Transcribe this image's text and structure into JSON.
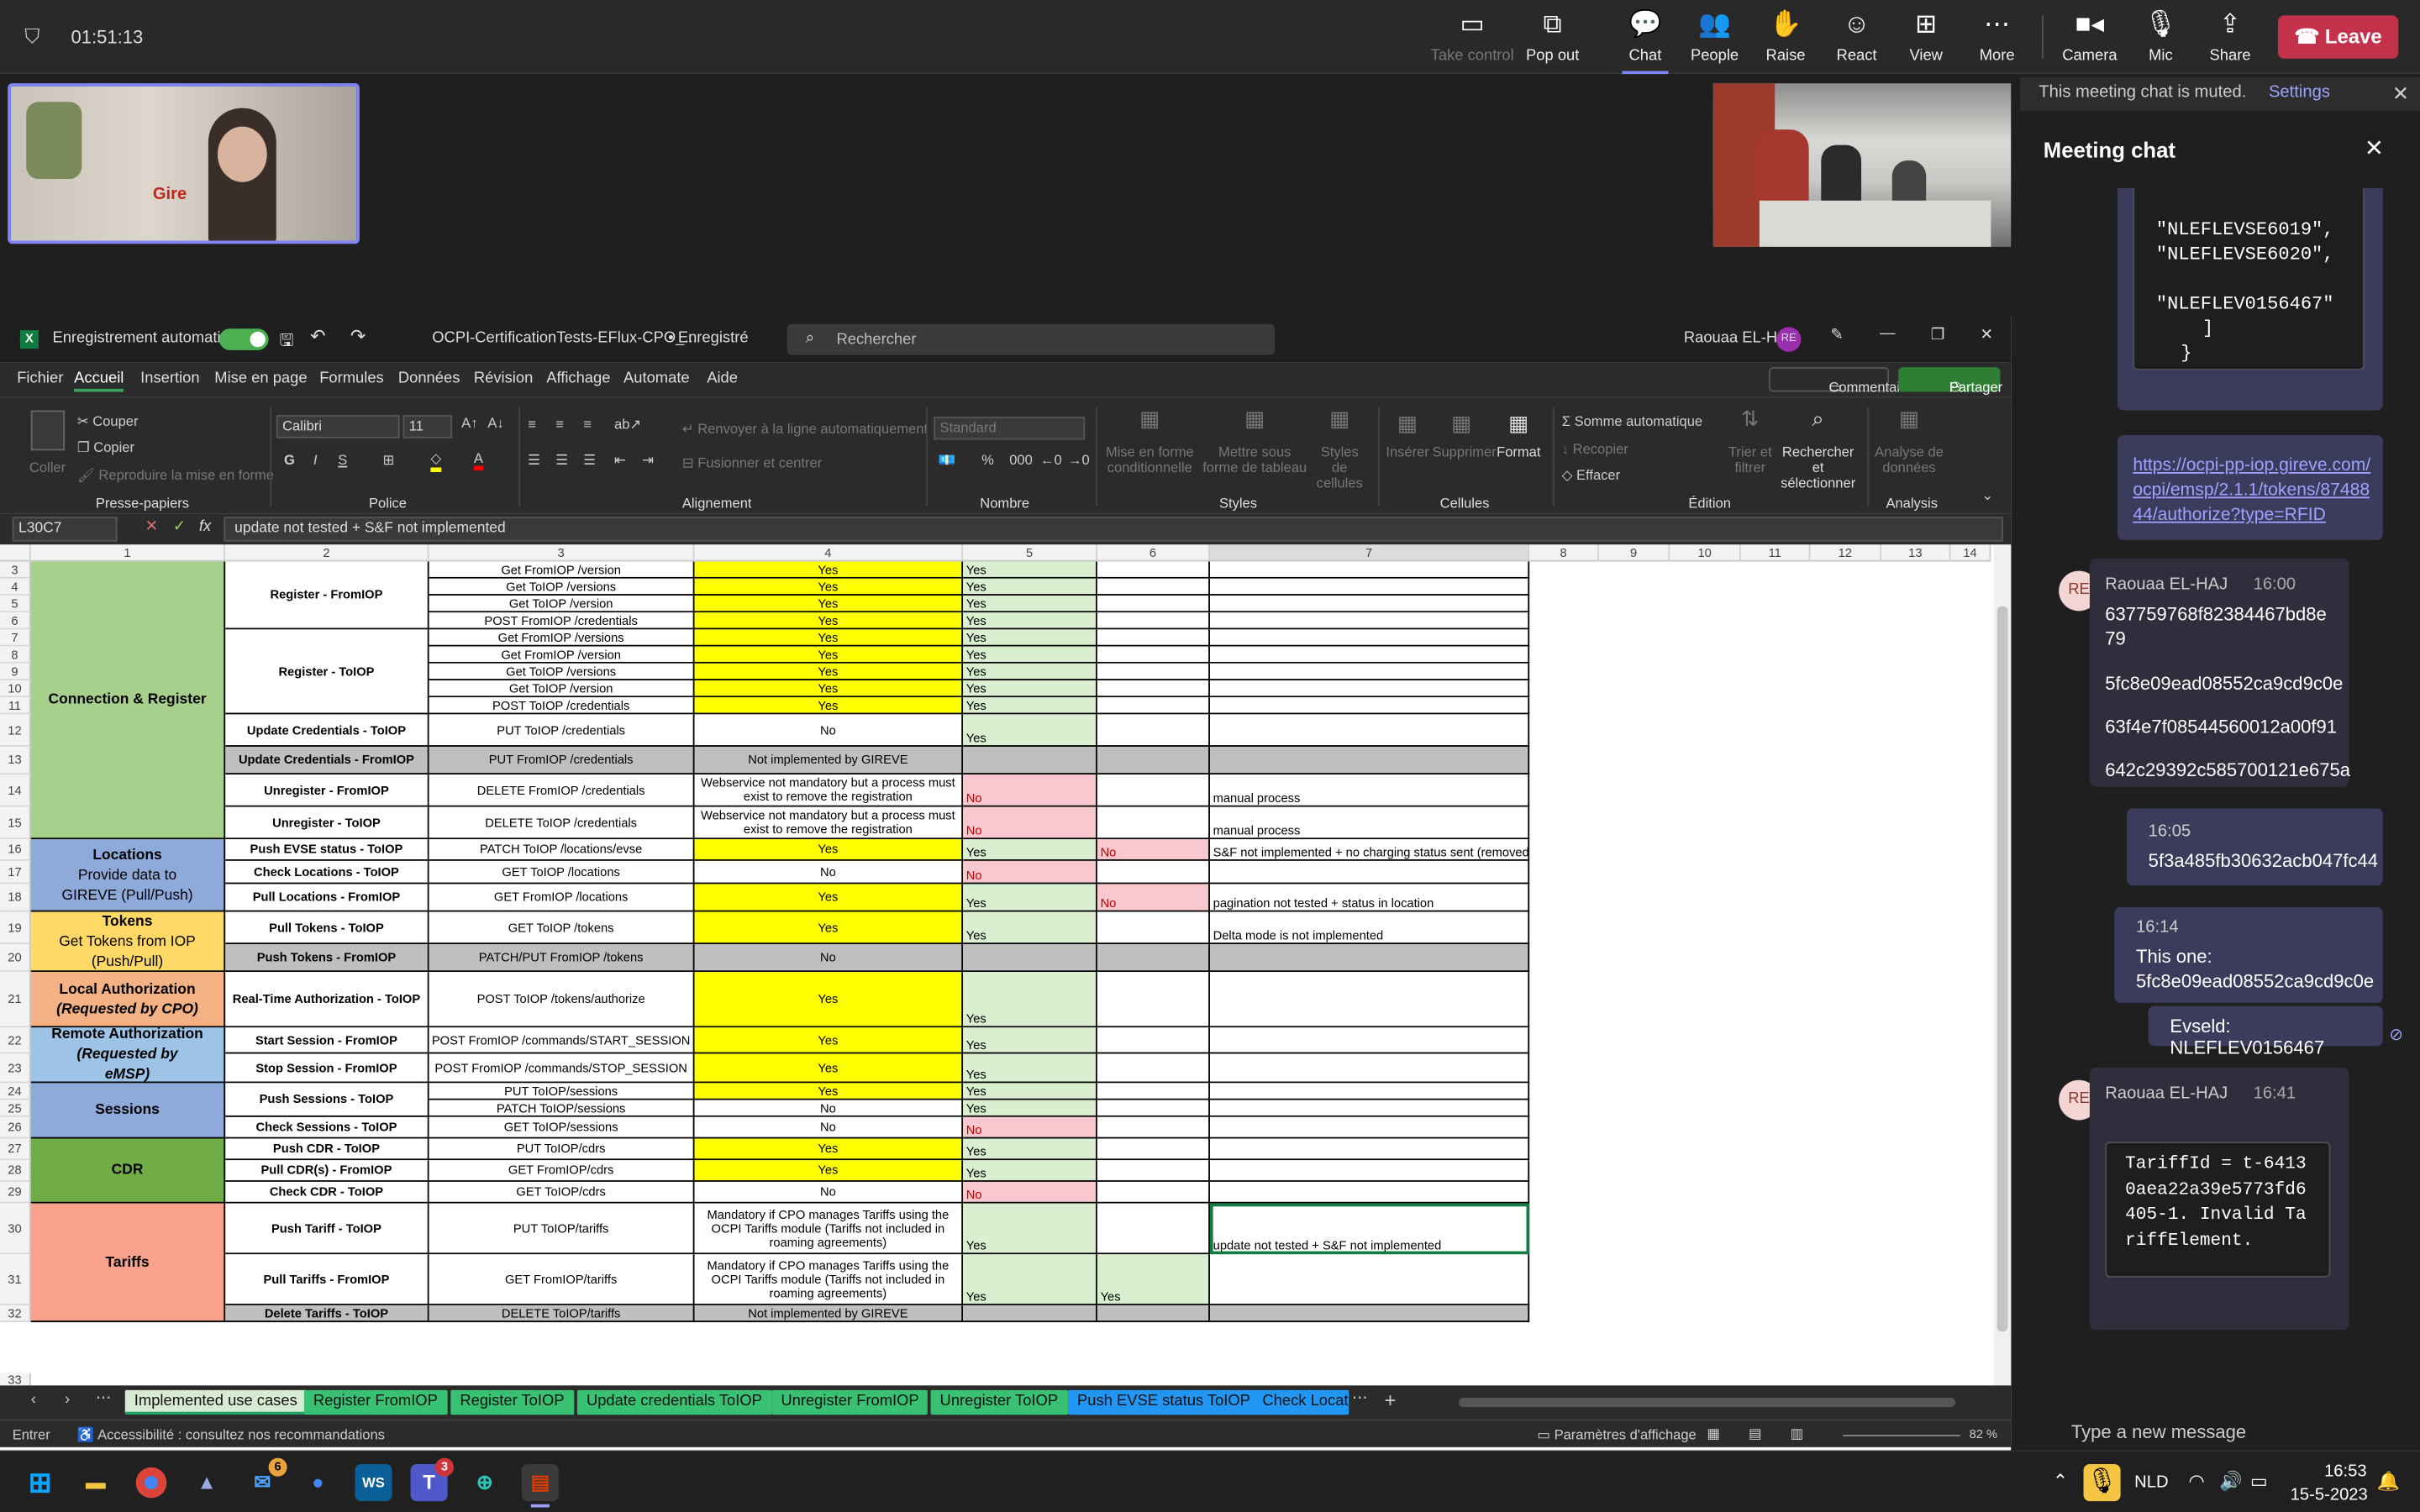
{
  "meeting": {
    "time": "01:51:13",
    "buttons": [
      "Take control",
      "Pop out",
      "Chat",
      "People",
      "Raise",
      "React",
      "View",
      "More",
      "Camera",
      "Mic",
      "Share"
    ],
    "leave": "Leave"
  },
  "excel": {
    "autosave": "Enregistrement automatique",
    "filename": "OCPI-CertificationTests-EFlux-CPO_...",
    "saved": "• Enregistré",
    "search": "Rechercher",
    "user": "Raouaa EL-HAJ",
    "initials": "RE",
    "menu": [
      "Fichier",
      "Accueil",
      "Insertion",
      "Mise en page",
      "Formules",
      "Données",
      "Révision",
      "Affichage",
      "Automate",
      "Aide"
    ],
    "comments": "Commentaires",
    "share": "Partager",
    "clipboard": {
      "paste": "Coller",
      "cut": "Couper",
      "copy": "Copier",
      "format": "Reproduire la mise en forme",
      "group": "Presse-papiers"
    },
    "font": {
      "name": "Calibri",
      "size": "11",
      "group": "Police"
    },
    "align": {
      "wrap": "Renvoyer à la ligne automatiquement",
      "merge": "Fusionner et centrer",
      "group": "Alignement"
    },
    "number": {
      "format": "Standard",
      "group": "Nombre"
    },
    "styles": {
      "cond": "Mise en forme conditionnelle",
      "table": "Mettre sous forme de tableau",
      "cell": "Styles de cellules",
      "group": "Styles"
    },
    "cells": {
      "insert": "Insérer",
      "delete": "Supprimer",
      "format": "Format",
      "group": "Cellules"
    },
    "edit": {
      "sum": "Somme automatique",
      "fill": "Recopier",
      "clear": "Effacer",
      "sort": "Trier et filtrer",
      "find": "Rechercher et sélectionner",
      "group": "Édition"
    },
    "analysis": {
      "label": "Analyse de données",
      "group": "Analysis"
    },
    "namebox": "L30C7",
    "formula": "update not tested + S&F not implemented",
    "columns": [
      "1",
      "2",
      "3",
      "4",
      "5",
      "6",
      "7",
      "8",
      "9",
      "10",
      "11",
      "12",
      "13",
      "14"
    ],
    "groups": [
      {
        "label": "Connection & Register",
        "sub": "",
        "color": "#a8d08d"
      },
      {
        "label": "Locations",
        "sub": "Provide data to GIREVE (Pull/Push)",
        "color": "#8eaadb"
      },
      {
        "label": "Tokens",
        "sub": "Get Tokens from IOP (Push/Pull)",
        "color": "#ffd966"
      },
      {
        "label": "Local Authorization",
        "sub": "(Requested by CPO)",
        "color": "#f4b183"
      },
      {
        "label": "Remote Authorization",
        "sub": "(Requested by eMSP)",
        "color": "#9dc3e6"
      },
      {
        "label": "Sessions",
        "sub": "",
        "color": "#8eaadb"
      },
      {
        "label": "CDR",
        "sub": "",
        "color": "#70ad47"
      },
      {
        "label": "Tariffs",
        "sub": "",
        "color": "#f8a28c"
      }
    ],
    "rows": [
      {
        "n": "3",
        "c3": "Get FromIOP /version",
        "c4": "Yes",
        "c5": "Yes",
        "c6": "",
        "c7": ""
      },
      {
        "n": "4",
        "c3": "Get ToIOP /versions",
        "c4": "Yes",
        "c5": "Yes",
        "c6": "",
        "c7": ""
      },
      {
        "n": "5",
        "c3": "Get ToIOP /version",
        "c4": "Yes",
        "c5": "Yes",
        "c6": "",
        "c7": ""
      },
      {
        "n": "6",
        "c3": "POST FromIOP /credentials",
        "c4": "Yes",
        "c5": "Yes",
        "c6": "",
        "c7": ""
      },
      {
        "n": "7",
        "c3": "Get FromIOP /versions",
        "c4": "Yes",
        "c5": "Yes",
        "c6": "",
        "c7": ""
      },
      {
        "n": "8",
        "c3": "Get FromIOP /version",
        "c4": "Yes",
        "c5": "Yes",
        "c6": "",
        "c7": ""
      },
      {
        "n": "9",
        "c3": "Get ToIOP /versions",
        "c4": "Yes",
        "c5": "Yes",
        "c6": "",
        "c7": ""
      },
      {
        "n": "10",
        "c3": "Get ToIOP /version",
        "c4": "Yes",
        "c5": "Yes",
        "c6": "",
        "c7": ""
      },
      {
        "n": "11",
        "c3": "POST ToIOP /credentials",
        "c4": "Yes",
        "c5": "Yes",
        "c6": "",
        "c7": ""
      },
      {
        "n": "12",
        "c2": "Update Credentials - ToIOP",
        "c3": "PUT ToIOP /credentials",
        "c4": "No",
        "c5": "Yes",
        "c6": "",
        "c7": ""
      },
      {
        "n": "13",
        "c2": "Update Credentials - FromIOP",
        "c3": "PUT FromIOP /credentials",
        "c4": "Not implemented by GIREVE",
        "c5": "",
        "c6": "",
        "c7": ""
      },
      {
        "n": "14",
        "c2": "Unregister - FromIOP",
        "c3": "DELETE FromIOP /credentials",
        "c4": "Webservice not mandatory but a process must exist to remove the registration",
        "c5": "No",
        "c6": "",
        "c7": "manual process"
      },
      {
        "n": "15",
        "c2": "Unregister - ToIOP",
        "c3": "DELETE ToIOP /credentials",
        "c4": "Webservice not mandatory but a process must exist to remove the registration",
        "c5": "No",
        "c6": "",
        "c7": "manual process"
      },
      {
        "n": "16",
        "c2": "Push EVSE status - ToIOP",
        "c3": "PATCH  ToIOP /locations/evse",
        "c4": "Yes",
        "c5": "Yes",
        "c6": "No",
        "c7": "S&F not implemented + no charging status sent (removed sent )"
      },
      {
        "n": "17",
        "c2": "Check Locations - ToIOP",
        "c3": "GET ToIOP /locations",
        "c4": "No",
        "c5": "No",
        "c6": "",
        "c7": ""
      },
      {
        "n": "18",
        "c2": "Pull Locations - FromIOP",
        "c3": "GET FromIOP /locations",
        "c4": "Yes",
        "c5": "Yes",
        "c6": "No",
        "c7": "pagination not tested + status in location"
      },
      {
        "n": "19",
        "c2": "Pull Tokens - ToIOP",
        "c3": "GET ToIOP /tokens",
        "c4": "Yes",
        "c5": "Yes",
        "c6": "",
        "c7": "Delta mode is not implemented"
      },
      {
        "n": "20",
        "c2": "Push Tokens - FromIOP",
        "c3": "PATCH/PUT FromIOP /tokens",
        "c4": "No",
        "c5": "",
        "c6": "",
        "c7": ""
      },
      {
        "n": "21",
        "c2": "Real-Time Authorization - ToIOP",
        "c3": "POST ToIOP /tokens/authorize",
        "c4": "Yes",
        "c5": "Yes",
        "c6": "",
        "c7": ""
      },
      {
        "n": "22",
        "c2": "Start Session - FromIOP",
        "c3": "POST FromIOP /commands/START_SESSION",
        "c4": "Yes",
        "c5": "Yes",
        "c6": "",
        "c7": ""
      },
      {
        "n": "23",
        "c2": "Stop Session - FromIOP",
        "c3": "POST FromIOP /commands/STOP_SESSION",
        "c4": "Yes",
        "c5": "Yes",
        "c6": "",
        "c7": ""
      },
      {
        "n": "24",
        "c2": "Push Sessions - ToIOP",
        "c3": "PUT ToIOP/sessions",
        "c4": "Yes",
        "c5": "Yes",
        "c6": "",
        "c7": ""
      },
      {
        "n": "25",
        "c3": "PATCH ToIOP/sessions",
        "c4": "No",
        "c5": "Yes",
        "c6": "",
        "c7": ""
      },
      {
        "n": "26",
        "c2": "Check Sessions - ToIOP",
        "c3": "GET ToIOP/sessions",
        "c4": "No",
        "c5": "No",
        "c6": "",
        "c7": ""
      },
      {
        "n": "27",
        "c2": "Push CDR - ToIOP",
        "c3": "PUT ToIOP/cdrs",
        "c4": "Yes",
        "c5": "Yes",
        "c6": "",
        "c7": ""
      },
      {
        "n": "28",
        "c2": "Pull CDR(s) - FromIOP",
        "c3": "GET FromIOP/cdrs",
        "c4": "Yes",
        "c5": "Yes",
        "c6": "",
        "c7": ""
      },
      {
        "n": "29",
        "c2": "Check CDR - ToIOP",
        "c3": "GET ToIOP/cdrs",
        "c4": "No",
        "c5": "No",
        "c6": "",
        "c7": ""
      },
      {
        "n": "30",
        "c2": "Push Tariff - ToIOP",
        "c3": "PUT ToIOP/tariffs",
        "c4": "Mandatory if CPO manages Tariffs using the OCPI Tariffs module (Tariffs not included in roaming agreements)",
        "c5": "Yes",
        "c6": "",
        "c7": "update not tested + S&F not implemented"
      },
      {
        "n": "31",
        "c2": "Pull Tariffs - FromIOP",
        "c3": "GET FromIOP/tariffs",
        "c4": "Mandatory if CPO manages Tariffs using the OCPI Tariffs module (Tariffs not included in roaming agreements)",
        "c5": "Yes",
        "c6": "Yes",
        "c7": ""
      },
      {
        "n": "32",
        "c2": "Delete Tariffs - ToIOP",
        "c3": "DELETE ToIOP/tariffs",
        "c4": "Not implemented by GIREVE",
        "c5": "",
        "c6": "",
        "c7": ""
      }
    ],
    "merged": {
      "register_from": "Register - FromIOP",
      "register_to": "Register - ToIOP",
      "sessions_push": "Push Sessions - ToIOP"
    },
    "tabs": [
      "Implemented use cases",
      "Register FromIOP",
      "Register ToIOP",
      "Update credentials ToIOP",
      "Unregister FromIOP",
      "Unregister ToIOP",
      "Push EVSE status ToIOP",
      "Check Locat"
    ],
    "status": {
      "mode": "Entrer",
      "access": "Accessibilité : consultez nos recommandations",
      "display": "Paramètres d'affichage",
      "zoom": "82 %"
    }
  },
  "chat": {
    "muted": "This meeting chat is muted.",
    "settings": "Settings",
    "title": "Meeting chat",
    "code1": [
      "\"NLEFLEVSE6019\",",
      "\"NLEFLEVSE6020\",",
      "\"NLEFLEV0156467\"",
      "]",
      "}"
    ],
    "link": "https://ocpi-pp-iop.gireve.com/ocpi/emsp/2.1.1/tokens/8748844/authorize?type=RFID",
    "msg1": {
      "author": "Raouaa EL-HAJ",
      "time": "16:00",
      "lines": [
        "637759768f82384467bd8e79",
        "5fc8e09ead08552ca9cd9c0e",
        "63f4e7f08544560012a00f91",
        "642c29392c585700121e675a"
      ]
    },
    "me1": {
      "time": "16:05",
      "text": "5f3a485fb30632acb047fc44"
    },
    "me2": {
      "time": "16:14",
      "text": "This one: 5fc8e09ead08552ca9cd9c0e"
    },
    "me3": {
      "text": "Evseld: NLEFLEV0156467"
    },
    "msg2": {
      "author": "Raouaa EL-HAJ",
      "time": "16:41",
      "code": "TariffId = t-64130aea22a39e5773fd6405-1. Invalid TariffElement."
    },
    "compose": "Type a new message"
  },
  "taskbar": {
    "lang": "NLD",
    "time": "16:53",
    "date": "15-5-2023",
    "mail_badge": "6",
    "teams_badge": "3"
  }
}
